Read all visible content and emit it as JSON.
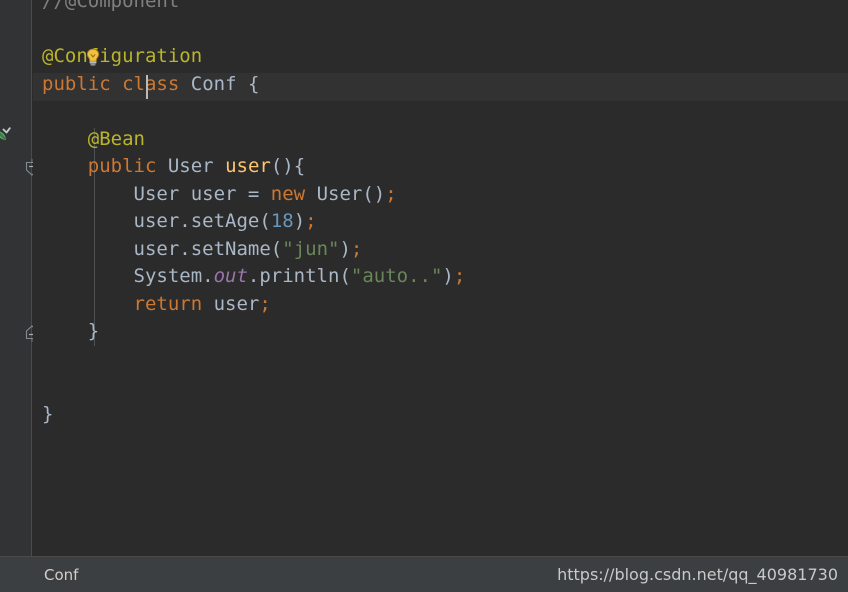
{
  "app": {
    "theme_name": "darcula",
    "background": "#2b2b2b",
    "gutter_background": "#313335",
    "current_line_background": "#323232",
    "status_bar_background": "#3c3f41"
  },
  "gutter": {
    "icons": [
      {
        "name": "spring-bean-icon",
        "title": "Spring bean"
      },
      {
        "name": "fold-start-icon",
        "title": "Collapse block"
      },
      {
        "name": "fold-end-icon",
        "title": "Collapse block end"
      }
    ]
  },
  "editor": {
    "caret": {
      "line": 4,
      "column": 15
    },
    "intention_icon": "lightbulb-icon",
    "code_lines": [
      {
        "id": "line-comment",
        "tokens": [
          {
            "text": "//@Component",
            "type": "comment"
          }
        ]
      },
      {
        "id": "line-blank-1",
        "tokens": [
          {
            "text": " ",
            "type": "plain"
          }
        ]
      },
      {
        "id": "line-annotation-configuration",
        "tokens": [
          {
            "text": "@Configuration",
            "type": "anno"
          }
        ]
      },
      {
        "id": "line-class-decl",
        "tokens": [
          {
            "text": "public",
            "type": "keyword"
          },
          {
            "text": " ",
            "type": "plain"
          },
          {
            "text": "class",
            "type": "keyword"
          },
          {
            "text": " ",
            "type": "plain"
          },
          {
            "text": "Conf",
            "type": "type"
          },
          {
            "text": " ",
            "type": "plain"
          },
          {
            "text": "{",
            "type": "brace"
          }
        ]
      },
      {
        "id": "line-blank-2",
        "tokens": [
          {
            "text": " ",
            "type": "plain"
          }
        ]
      },
      {
        "id": "line-annotation-bean",
        "tokens": [
          {
            "text": "    ",
            "type": "plain"
          },
          {
            "text": "@Bean",
            "type": "anno"
          }
        ]
      },
      {
        "id": "line-method-decl",
        "tokens": [
          {
            "text": "    ",
            "type": "plain"
          },
          {
            "text": "public",
            "type": "keyword"
          },
          {
            "text": " ",
            "type": "plain"
          },
          {
            "text": "User",
            "type": "type"
          },
          {
            "text": " ",
            "type": "plain"
          },
          {
            "text": "user",
            "type": "method"
          },
          {
            "text": "(){",
            "type": "brace"
          }
        ]
      },
      {
        "id": "line-new-user",
        "tokens": [
          {
            "text": "        ",
            "type": "plain"
          },
          {
            "text": "User user ",
            "type": "type"
          },
          {
            "text": "= ",
            "type": "plain"
          },
          {
            "text": "new",
            "type": "keyword"
          },
          {
            "text": " ",
            "type": "plain"
          },
          {
            "text": "User",
            "type": "type"
          },
          {
            "text": "()",
            "type": "brace"
          },
          {
            "text": ";",
            "type": "punct"
          }
        ]
      },
      {
        "id": "line-set-age",
        "tokens": [
          {
            "text": "        ",
            "type": "plain"
          },
          {
            "text": "user.setAge",
            "type": "plain"
          },
          {
            "text": "(",
            "type": "brace"
          },
          {
            "text": "18",
            "type": "number"
          },
          {
            "text": ")",
            "type": "brace"
          },
          {
            "text": ";",
            "type": "punct"
          }
        ]
      },
      {
        "id": "line-set-name",
        "tokens": [
          {
            "text": "        ",
            "type": "plain"
          },
          {
            "text": "user.setName",
            "type": "plain"
          },
          {
            "text": "(",
            "type": "brace"
          },
          {
            "text": "\"jun\"",
            "type": "string"
          },
          {
            "text": ")",
            "type": "brace"
          },
          {
            "text": ";",
            "type": "punct"
          }
        ]
      },
      {
        "id": "line-println",
        "tokens": [
          {
            "text": "        ",
            "type": "plain"
          },
          {
            "text": "System.",
            "type": "plain"
          },
          {
            "text": "out",
            "type": "static"
          },
          {
            "text": ".println",
            "type": "plain"
          },
          {
            "text": "(",
            "type": "brace"
          },
          {
            "text": "\"auto..\"",
            "type": "string"
          },
          {
            "text": ")",
            "type": "brace"
          },
          {
            "text": ";",
            "type": "punct"
          }
        ]
      },
      {
        "id": "line-return",
        "tokens": [
          {
            "text": "        ",
            "type": "plain"
          },
          {
            "text": "return",
            "type": "keyword"
          },
          {
            "text": " ",
            "type": "plain"
          },
          {
            "text": "user",
            "type": "plain"
          },
          {
            "text": ";",
            "type": "punct"
          }
        ]
      },
      {
        "id": "line-close-method",
        "tokens": [
          {
            "text": "    ",
            "type": "plain"
          },
          {
            "text": "}",
            "type": "brace"
          }
        ]
      },
      {
        "id": "line-blank-3",
        "tokens": [
          {
            "text": " ",
            "type": "plain"
          }
        ]
      },
      {
        "id": "line-blank-4",
        "tokens": [
          {
            "text": " ",
            "type": "plain"
          }
        ]
      },
      {
        "id": "line-close-class",
        "tokens": [
          {
            "text": "}",
            "type": "brace"
          }
        ]
      }
    ]
  },
  "status_bar": {
    "breadcrumb": "Conf",
    "watermark": "https://blog.csdn.net/qq_40981730"
  }
}
